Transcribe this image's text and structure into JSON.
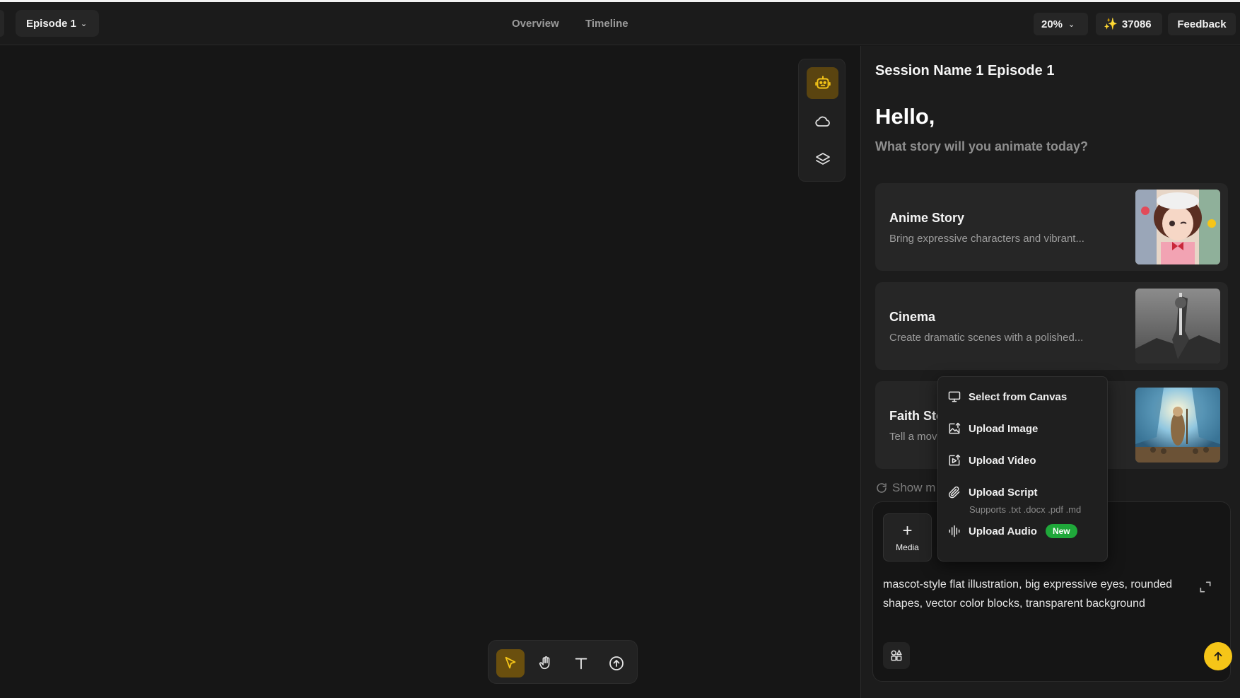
{
  "topbar": {
    "episode_label": "Episode 1",
    "tabs": [
      {
        "label": "Overview"
      },
      {
        "label": "Timeline"
      }
    ],
    "zoom": "20%",
    "credits": "37086",
    "feedback_label": "Feedback"
  },
  "side_tools": [
    "robot-icon",
    "cloud-icon",
    "layers-icon"
  ],
  "bottom_tools": [
    "select-arrow-icon",
    "hand-icon",
    "text-icon",
    "upload-icon"
  ],
  "panel": {
    "session_title": "Session Name 1 Episode 1",
    "greeting": "Hello,",
    "subtitle": "What story will you animate today?",
    "cards": [
      {
        "title": "Anime Story",
        "desc": "Bring expressive characters and vibrant..."
      },
      {
        "title": "Cinema",
        "desc": "Create dramatic scenes with a polished..."
      },
      {
        "title": "Faith Sto",
        "desc": "Tell a mov"
      }
    ],
    "show_more": "Show m",
    "composer": {
      "media_label": "Media",
      "prompt_text": "mascot-style flat illustration, big expressive eyes, rounded shapes, vector color blocks, transparent background"
    }
  },
  "menu": {
    "items": [
      {
        "label": "Select from Canvas",
        "icon": "monitor-icon"
      },
      {
        "label": "Upload Image",
        "icon": "image-upload-icon"
      },
      {
        "label": "Upload Video",
        "icon": "video-upload-icon"
      },
      {
        "label": "Upload Script",
        "icon": "paperclip-icon"
      },
      {
        "label": "Upload Audio",
        "icon": "audio-wave-icon"
      }
    ],
    "script_hint": "Supports .txt .docx .pdf .md",
    "new_badge": "New"
  },
  "colors": {
    "accent": "#f5c518",
    "new_badge": "#1fa83a",
    "background": "#161616"
  }
}
